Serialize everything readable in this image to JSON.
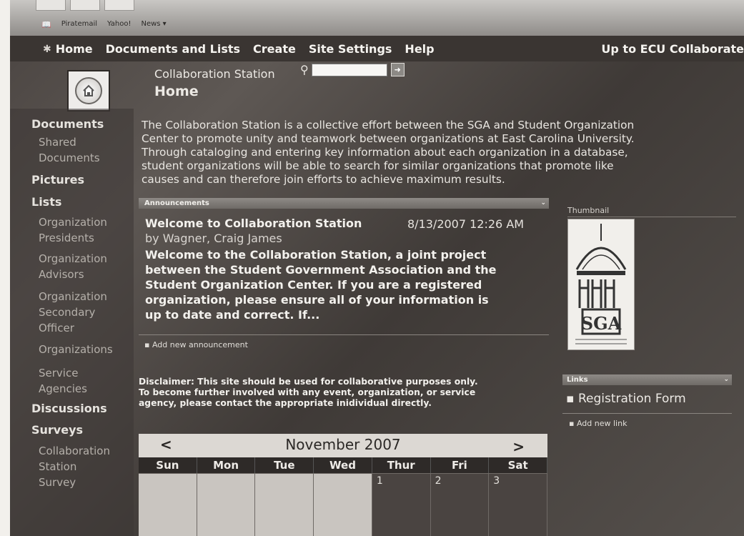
{
  "browser": {
    "bookmarks": [
      "Piratemail",
      "Yahoo!",
      "News ▾"
    ]
  },
  "topnav": {
    "items": [
      "Home",
      "Documents and Lists",
      "Create",
      "Site Settings",
      "Help"
    ],
    "right_link": "Up to ECU Collaborate"
  },
  "site": {
    "name": "Collaboration Station",
    "page_title": "Home"
  },
  "search": {
    "placeholder": ""
  },
  "sidebar": {
    "documents_heading": "Documents",
    "documents_items": [
      "Shared",
      "Documents"
    ],
    "pictures_heading": "Pictures",
    "lists_heading": "Lists",
    "lists_items": [
      [
        "Organization",
        "Presidents"
      ],
      [
        "Organization",
        "Advisors"
      ],
      [
        "Organization",
        "Secondary",
        "Officer"
      ],
      [
        "Organizations"
      ],
      [
        "Service",
        "Agencies"
      ]
    ],
    "discussions_heading": "Discussions",
    "surveys_heading": "Surveys",
    "surveys_items": [
      "Collaboration",
      "Station",
      "Survey"
    ]
  },
  "intro_lines": [
    "The Collaboration Station is a collective effort between the SGA and Student Organization",
    "Center to promote unity and teamwork between organizations at East Carolina University.",
    "Through cataloging and entering key information about each organization in a database,",
    "student organizations will be able to search for similar organizations that promote like",
    "causes and can therefore join efforts to achieve maximum results."
  ],
  "announcements": {
    "header": "Announcements",
    "title": "Welcome to Collaboration Station",
    "date": "8/13/2007 12:26 AM",
    "author": "by Wagner, Craig James",
    "body_lines": [
      "Welcome to the Collaboration Station, a joint project",
      "between the Student Government Association and the",
      "Student Organization Center.  If you are a registered",
      "organization, please ensure all of your information is",
      "up to date and correct.  If..."
    ],
    "add_link": "Add new announcement"
  },
  "disclaimer_lines": [
    "Disclaimer: This site should be used for collaborative purposes only.",
    "To become further involved with any event, organization, or service",
    "agency, please contact the appropriate inidividual directly."
  ],
  "calendar": {
    "prev": "<",
    "next": ">",
    "month": "November 2007",
    "days": [
      "Sun",
      "Mon",
      "Tue",
      "Wed",
      "Thur",
      "Fri",
      "Sat"
    ],
    "cells": [
      "",
      "",
      "",
      "",
      "1",
      "2",
      "3"
    ]
  },
  "thumbnail": {
    "label": "Thumbnail",
    "logo_text": "SGA"
  },
  "links": {
    "header": "Links",
    "items": [
      "Registration Form"
    ],
    "add_link": "Add new link"
  }
}
